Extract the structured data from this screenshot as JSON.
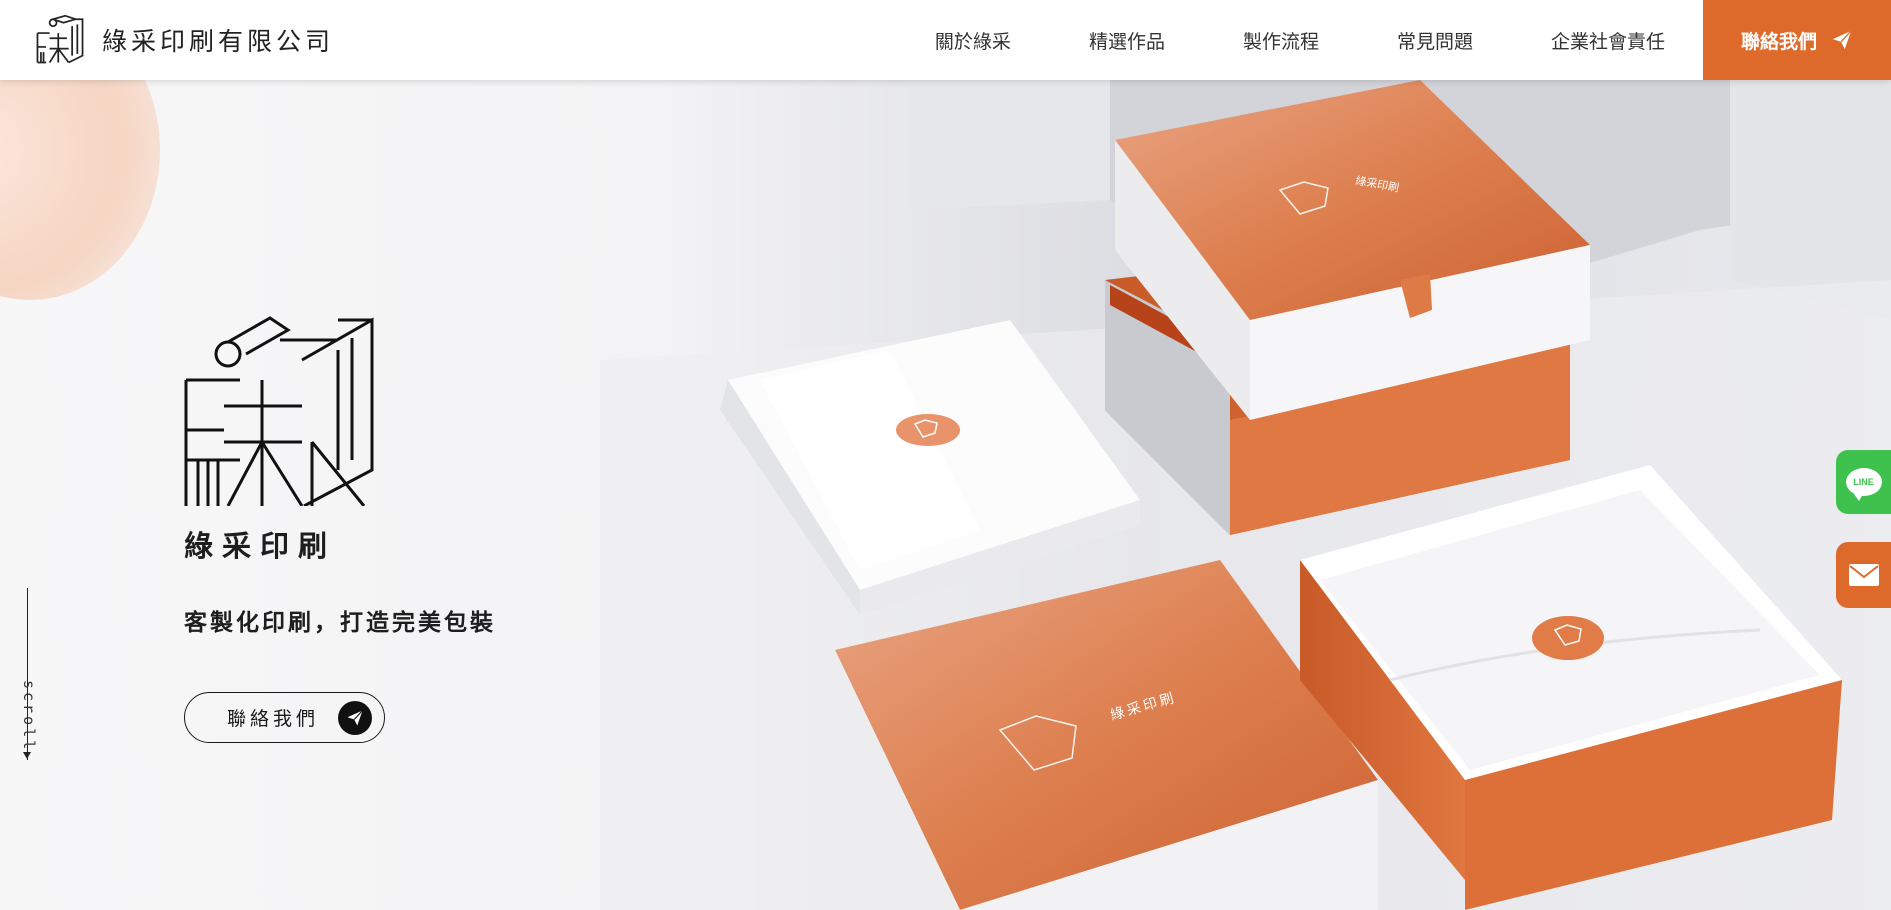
{
  "header": {
    "brand_name": "綠采印刷有限公司",
    "nav": [
      {
        "label": "關於綠采"
      },
      {
        "label": "精選作品"
      },
      {
        "label": "製作流程"
      },
      {
        "label": "常見問題"
      },
      {
        "label": "企業社會責任"
      }
    ],
    "contact_label": "聯絡我們"
  },
  "hero": {
    "brand": "綠采印刷",
    "tagline": "客製化印刷，打造完美包裝",
    "cta_label": "聯絡我們",
    "scroll_label": "scroll",
    "box_brand_text": "綠采印刷"
  },
  "floating": {
    "line_label": "LINE"
  },
  "colors": {
    "accent": "#dd6a2b",
    "line_green": "#3fc14d",
    "text": "#1e1e1e"
  }
}
